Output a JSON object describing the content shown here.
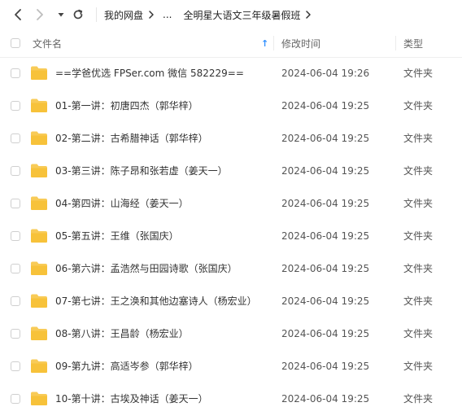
{
  "breadcrumb": {
    "items": [
      "我的网盘",
      "...",
      "全明星大语文三年级暑假班"
    ]
  },
  "columns": {
    "name": "文件名",
    "modified": "修改时间",
    "type": "类型"
  },
  "sort_indicator": "↑",
  "colors": {
    "folder": "#f7c23a",
    "sort_arrow": "#2f8fff"
  },
  "files": [
    {
      "name": "==学爸优选 FPSer.com 微信 582229==",
      "modified": "2024-06-04 19:26",
      "type": "文件夹"
    },
    {
      "name": "01-第一讲：初唐四杰（郭华梓）",
      "modified": "2024-06-04 19:25",
      "type": "文件夹"
    },
    {
      "name": "02-第二讲：古希腊神话（郭华梓）",
      "modified": "2024-06-04 19:25",
      "type": "文件夹"
    },
    {
      "name": "03-第三讲：陈子昂和张若虚（姜天一）",
      "modified": "2024-06-04 19:25",
      "type": "文件夹"
    },
    {
      "name": "04-第四讲：山海经（姜天一）",
      "modified": "2024-06-04 19:25",
      "type": "文件夹"
    },
    {
      "name": "05-第五讲：王维（张国庆）",
      "modified": "2024-06-04 19:25",
      "type": "文件夹"
    },
    {
      "name": "06-第六讲：孟浩然与田园诗歌（张国庆）",
      "modified": "2024-06-04 19:25",
      "type": "文件夹"
    },
    {
      "name": "07-第七讲：王之涣和其他边塞诗人（杨宏业）",
      "modified": "2024-06-04 19:25",
      "type": "文件夹"
    },
    {
      "name": "08-第八讲：王昌龄（杨宏业）",
      "modified": "2024-06-04 19:25",
      "type": "文件夹"
    },
    {
      "name": "09-第九讲：高适岑参（郭华梓）",
      "modified": "2024-06-04 19:25",
      "type": "文件夹"
    },
    {
      "name": "10-第十讲：古埃及神话（姜天一）",
      "modified": "2024-06-04 19:25",
      "type": "文件夹"
    }
  ]
}
